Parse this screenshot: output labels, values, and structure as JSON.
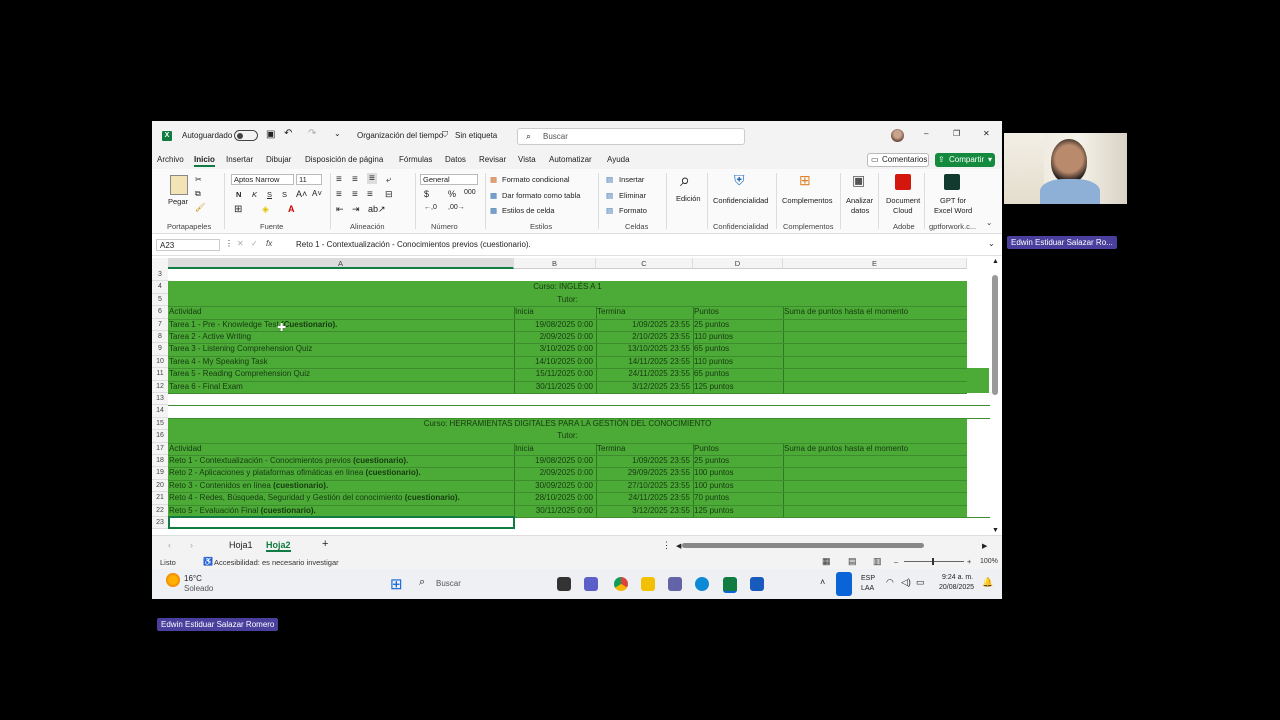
{
  "titlebar": {
    "autosave_label": "Autoguardado",
    "doc_title": "Organización del tiempo",
    "sensitivity": "Sin etiqueta",
    "search_placeholder": "Buscar"
  },
  "menu": [
    "Archivo",
    "Inicio",
    "Insertar",
    "Dibujar",
    "Disposición de página",
    "Fórmulas",
    "Datos",
    "Revisar",
    "Vista",
    "Automatizar",
    "Ayuda"
  ],
  "menu_actions": {
    "comments": "Comentarios",
    "share": "Compartir"
  },
  "ribbon": {
    "paste": "Pegar",
    "font_name": "Aptos Narrow",
    "font_size": "11",
    "number_format": "General",
    "conditional_format": "Formato condicional",
    "format_as_table": "Dar formato como tabla",
    "cell_styles": "Estilos de celda",
    "insert": "Insertar",
    "delete": "Eliminar",
    "format": "Formato",
    "editing": "Edición",
    "confidentiality": "Confidencialidad",
    "addins": "Complementos",
    "analyze": [
      "Analizar",
      "datos"
    ],
    "document_cloud": [
      "Document",
      "Cloud"
    ],
    "gpt": [
      "GPT for",
      "Excel Word"
    ],
    "groups": [
      "Portapapeles",
      "Fuente",
      "Alineación",
      "Número",
      "Estilos",
      "Celdas",
      "Confidencialidad",
      "Complementos",
      "Adobe",
      "gptforwork.c..."
    ]
  },
  "formula_bar": {
    "name_box": "A23",
    "fx": "fx",
    "formula": "Reto 1 - Contextualización - Conocimientos previos (cuestionario)."
  },
  "columns": [
    "A",
    "B",
    "C",
    "D",
    "E"
  ],
  "rows": [
    "3",
    "4",
    "5",
    "6",
    "7",
    "8",
    "9",
    "10",
    "11",
    "12",
    "13",
    "14",
    "15",
    "16",
    "17",
    "18",
    "19",
    "20",
    "21",
    "22",
    "23"
  ],
  "course1": {
    "title": "Curso: INGLÉS A 1",
    "tutor": "Tutor:",
    "headers": [
      "Actividad",
      "Inicia",
      "Termina",
      "Puntos",
      "Suma de puntos hasta el momento"
    ],
    "tasks": [
      {
        "act": "Tarea 1 - Pre - Knowledge Test",
        "bold": " (Cuestionario).",
        "start": "19/08/2025 0:00",
        "end": "1/09/2025 23:55",
        "pts": "25 puntos"
      },
      {
        "act": "Tarea 2 - Active Writing",
        "bold": "",
        "start": "2/09/2025 0:00",
        "end": "2/10/2025 23:55",
        "pts": "110 puntos"
      },
      {
        "act": "Tarea 3 - Listening Comprehension Quiz",
        "bold": "",
        "start": "3/10/2025 0:00",
        "end": "13/10/2025 23:55",
        "pts": "65 puntos"
      },
      {
        "act": "Tarea 4 - My Speaking Task",
        "bold": "",
        "start": "14/10/2025 0:00",
        "end": "14/11/2025 23:55",
        "pts": "110 puntos"
      },
      {
        "act": "Tarea 5 - Reading Comprehension Quiz",
        "bold": "",
        "start": "15/11/2025 0:00",
        "end": "24/11/2025 23:55",
        "pts": "65 puntos"
      },
      {
        "act": "Tarea 6 - Final Exam",
        "bold": "",
        "start": "30/11/2025 0:00",
        "end": "3/12/2025 23:55",
        "pts": "125 puntos"
      }
    ]
  },
  "course2": {
    "title": "Curso: HERRAMIENTAS DIGITALES PARA LA GESTIÓN DEL CONOCIMIENTO",
    "tutor": "Tutor:",
    "headers": [
      "Actividad",
      "Inicia",
      "Termina",
      "Puntos",
      "Suma de puntos hasta el momento"
    ],
    "tasks": [
      {
        "act": "Reto 1 - Contextualización - Conocimientos previos ",
        "bold": "(cuestionario).",
        "start": "19/08/2025 0:00",
        "end": "1/09/2025 23:55",
        "pts": "25 puntos"
      },
      {
        "act": "Reto 2 - Aplicaciones y plataformas ofimáticas en línea ",
        "bold": "(cuestionario).",
        "start": "2/09/2025 0:00",
        "end": "29/09/2025 23:55",
        "pts": "100 puntos"
      },
      {
        "act": "Reto 3 - Contenidos en línea ",
        "bold": "(cuestionario).",
        "start": "30/09/2025 0:00",
        "end": "27/10/2025 23:55",
        "pts": "100 puntos"
      },
      {
        "act": "Reto 4 - Redes, Búsqueda, Seguridad y Gestión del conocimiento ",
        "bold": "(cuestionario).",
        "start": "28/10/2025 0:00",
        "end": "24/11/2025 23:55",
        "pts": "70 puntos"
      },
      {
        "act": "Reto 5 - Evaluación Final ",
        "bold": "(cuestionario).",
        "start": "30/11/2025 0:00",
        "end": "3/12/2025 23:55",
        "pts": "125 puntos"
      }
    ]
  },
  "sheets": [
    "Hoja1",
    "Hoja2"
  ],
  "status": {
    "ready": "Listo",
    "accessibility": "Accesibilidad: es necesario investigar",
    "zoom": "100%"
  },
  "taskbar": {
    "temp": "16°C",
    "weather": "Soleado",
    "search": "Buscar",
    "lang": [
      "ESP",
      "LAA"
    ],
    "time": "9:24 a. m.",
    "date": "20/08/2025"
  },
  "participant_name": "Edwin Estiduar Salazar Romero",
  "participant_name_short": "Edwin Estiduar Salazar Ro...",
  "colors": {
    "sheet_green": "#4caa37",
    "excel_green": "#107c41"
  }
}
